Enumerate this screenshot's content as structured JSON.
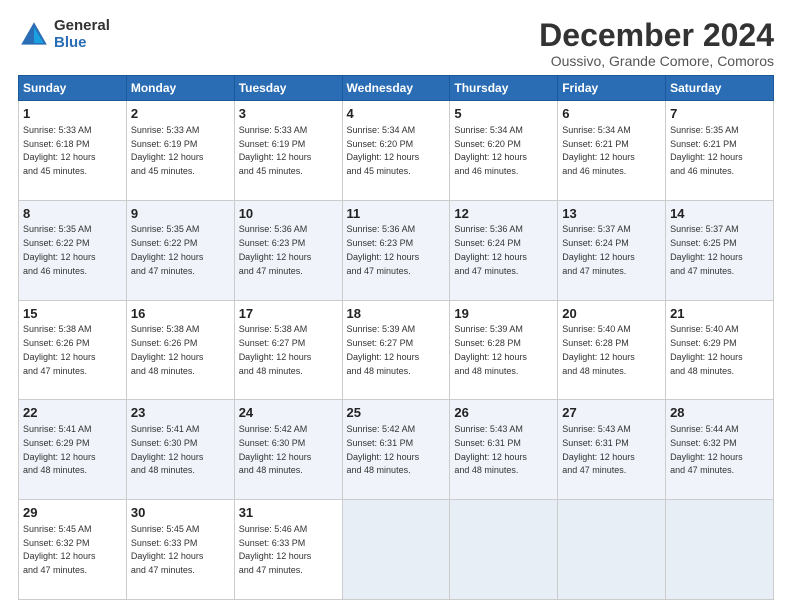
{
  "logo": {
    "general": "General",
    "blue": "Blue"
  },
  "title": "December 2024",
  "subtitle": "Oussivo, Grande Comore, Comoros",
  "days_of_week": [
    "Sunday",
    "Monday",
    "Tuesday",
    "Wednesday",
    "Thursday",
    "Friday",
    "Saturday"
  ],
  "weeks": [
    [
      {
        "day": 1,
        "sunrise": "5:33 AM",
        "sunset": "6:18 PM",
        "daylight": "12 hours and 45 minutes."
      },
      {
        "day": 2,
        "sunrise": "5:33 AM",
        "sunset": "6:19 PM",
        "daylight": "12 hours and 45 minutes."
      },
      {
        "day": 3,
        "sunrise": "5:33 AM",
        "sunset": "6:19 PM",
        "daylight": "12 hours and 45 minutes."
      },
      {
        "day": 4,
        "sunrise": "5:34 AM",
        "sunset": "6:20 PM",
        "daylight": "12 hours and 45 minutes."
      },
      {
        "day": 5,
        "sunrise": "5:34 AM",
        "sunset": "6:20 PM",
        "daylight": "12 hours and 46 minutes."
      },
      {
        "day": 6,
        "sunrise": "5:34 AM",
        "sunset": "6:21 PM",
        "daylight": "12 hours and 46 minutes."
      },
      {
        "day": 7,
        "sunrise": "5:35 AM",
        "sunset": "6:21 PM",
        "daylight": "12 hours and 46 minutes."
      }
    ],
    [
      {
        "day": 8,
        "sunrise": "5:35 AM",
        "sunset": "6:22 PM",
        "daylight": "12 hours and 46 minutes."
      },
      {
        "day": 9,
        "sunrise": "5:35 AM",
        "sunset": "6:22 PM",
        "daylight": "12 hours and 47 minutes."
      },
      {
        "day": 10,
        "sunrise": "5:36 AM",
        "sunset": "6:23 PM",
        "daylight": "12 hours and 47 minutes."
      },
      {
        "day": 11,
        "sunrise": "5:36 AM",
        "sunset": "6:23 PM",
        "daylight": "12 hours and 47 minutes."
      },
      {
        "day": 12,
        "sunrise": "5:36 AM",
        "sunset": "6:24 PM",
        "daylight": "12 hours and 47 minutes."
      },
      {
        "day": 13,
        "sunrise": "5:37 AM",
        "sunset": "6:24 PM",
        "daylight": "12 hours and 47 minutes."
      },
      {
        "day": 14,
        "sunrise": "5:37 AM",
        "sunset": "6:25 PM",
        "daylight": "12 hours and 47 minutes."
      }
    ],
    [
      {
        "day": 15,
        "sunrise": "5:38 AM",
        "sunset": "6:26 PM",
        "daylight": "12 hours and 47 minutes."
      },
      {
        "day": 16,
        "sunrise": "5:38 AM",
        "sunset": "6:26 PM",
        "daylight": "12 hours and 48 minutes."
      },
      {
        "day": 17,
        "sunrise": "5:38 AM",
        "sunset": "6:27 PM",
        "daylight": "12 hours and 48 minutes."
      },
      {
        "day": 18,
        "sunrise": "5:39 AM",
        "sunset": "6:27 PM",
        "daylight": "12 hours and 48 minutes."
      },
      {
        "day": 19,
        "sunrise": "5:39 AM",
        "sunset": "6:28 PM",
        "daylight": "12 hours and 48 minutes."
      },
      {
        "day": 20,
        "sunrise": "5:40 AM",
        "sunset": "6:28 PM",
        "daylight": "12 hours and 48 minutes."
      },
      {
        "day": 21,
        "sunrise": "5:40 AM",
        "sunset": "6:29 PM",
        "daylight": "12 hours and 48 minutes."
      }
    ],
    [
      {
        "day": 22,
        "sunrise": "5:41 AM",
        "sunset": "6:29 PM",
        "daylight": "12 hours and 48 minutes."
      },
      {
        "day": 23,
        "sunrise": "5:41 AM",
        "sunset": "6:30 PM",
        "daylight": "12 hours and 48 minutes."
      },
      {
        "day": 24,
        "sunrise": "5:42 AM",
        "sunset": "6:30 PM",
        "daylight": "12 hours and 48 minutes."
      },
      {
        "day": 25,
        "sunrise": "5:42 AM",
        "sunset": "6:31 PM",
        "daylight": "12 hours and 48 minutes."
      },
      {
        "day": 26,
        "sunrise": "5:43 AM",
        "sunset": "6:31 PM",
        "daylight": "12 hours and 48 minutes."
      },
      {
        "day": 27,
        "sunrise": "5:43 AM",
        "sunset": "6:31 PM",
        "daylight": "12 hours and 47 minutes."
      },
      {
        "day": 28,
        "sunrise": "5:44 AM",
        "sunset": "6:32 PM",
        "daylight": "12 hours and 47 minutes."
      }
    ],
    [
      {
        "day": 29,
        "sunrise": "5:45 AM",
        "sunset": "6:32 PM",
        "daylight": "12 hours and 47 minutes."
      },
      {
        "day": 30,
        "sunrise": "5:45 AM",
        "sunset": "6:33 PM",
        "daylight": "12 hours and 47 minutes."
      },
      {
        "day": 31,
        "sunrise": "5:46 AM",
        "sunset": "6:33 PM",
        "daylight": "12 hours and 47 minutes."
      },
      null,
      null,
      null,
      null
    ]
  ]
}
